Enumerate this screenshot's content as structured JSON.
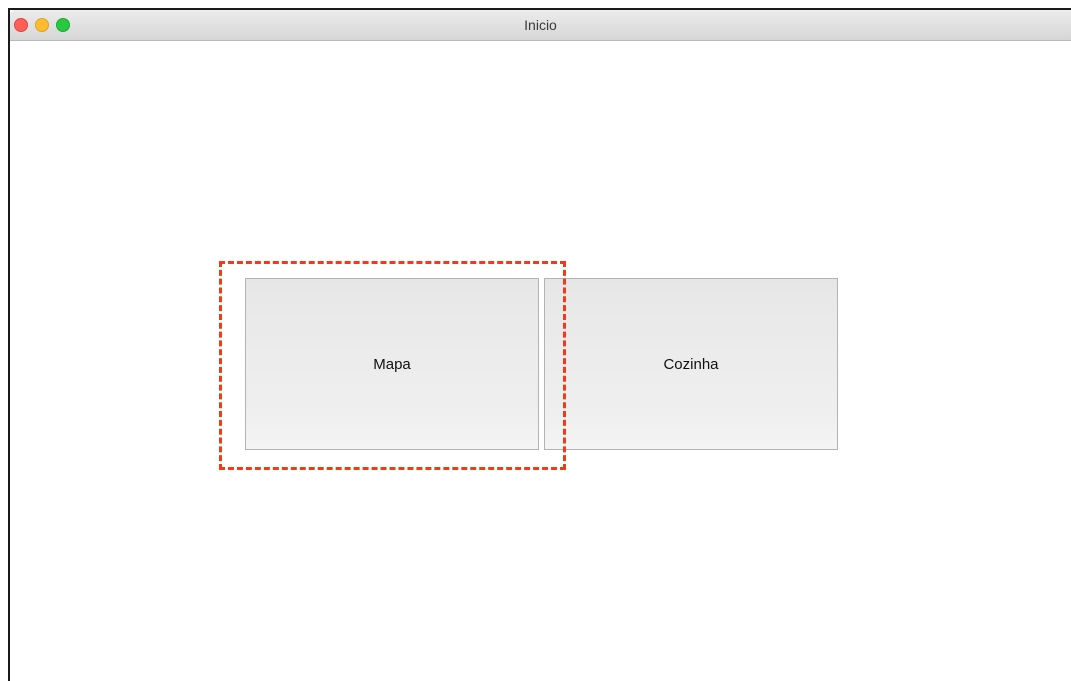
{
  "window": {
    "title": "Inicio"
  },
  "buttons": {
    "mapa": "Mapa",
    "cozinha": "Cozinha"
  },
  "colors": {
    "highlight": "#f03a1a",
    "close": "#fe5f57",
    "minimize": "#febc2e",
    "zoom": "#28c840"
  }
}
